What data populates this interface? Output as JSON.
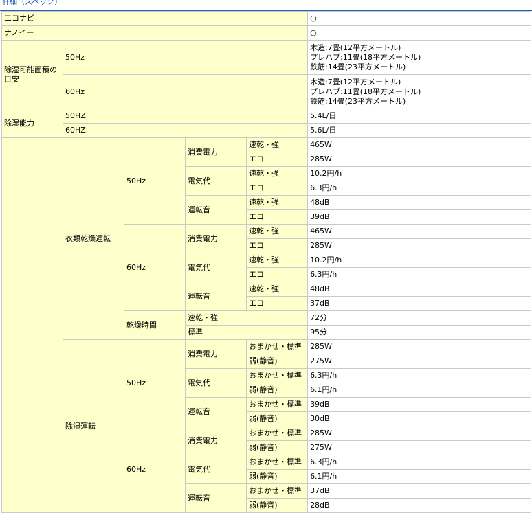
{
  "section_title": "詳細（スペック）",
  "rows": {
    "econavi": {
      "label": "エコナビ",
      "value": "○"
    },
    "nanoe": {
      "label": "ナノイー",
      "value": "○"
    },
    "area": {
      "label": "除湿可能面積の目安",
      "hz50": {
        "label": "50Hz",
        "lines": [
          "木造:7畳(12平方メートル)",
          "プレハブ:11畳(18平方メートル)",
          "鉄筋:14畳(23平方メートル)"
        ]
      },
      "hz60": {
        "label": "60Hz",
        "lines": [
          "木造:7畳(12平方メートル)",
          "プレハブ:11畳(18平方メートル)",
          "鉄筋:14畳(23平方メートル)"
        ]
      }
    },
    "capacity": {
      "label": "除湿能力",
      "hz50": {
        "label": "50HZ",
        "value": "5.4L/日"
      },
      "hz60": {
        "label": "60HZ",
        "value": "5.6L/日"
      }
    },
    "clothes": {
      "label": "衣類乾燥運転",
      "hz50": {
        "label": "50Hz",
        "power": {
          "label": "消費電力",
          "r1": {
            "mode": "速乾・強",
            "value": "465W"
          },
          "r2": {
            "mode": "エコ",
            "value": "285W"
          }
        },
        "cost": {
          "label": "電気代",
          "r1": {
            "mode": "速乾・強",
            "value": "10.2円/h"
          },
          "r2": {
            "mode": "エコ",
            "value": "6.3円/h"
          }
        },
        "noise": {
          "label": "運転音",
          "r1": {
            "mode": "速乾・強",
            "value": "48dB"
          },
          "r2": {
            "mode": "エコ",
            "value": "39dB"
          }
        }
      },
      "hz60": {
        "label": "60Hz",
        "power": {
          "label": "消費電力",
          "r1": {
            "mode": "速乾・強",
            "value": "465W"
          },
          "r2": {
            "mode": "エコ",
            "value": "285W"
          }
        },
        "cost": {
          "label": "電気代",
          "r1": {
            "mode": "速乾・強",
            "value": "10.2円/h"
          },
          "r2": {
            "mode": "エコ",
            "value": "6.3円/h"
          }
        },
        "noise": {
          "label": "運転音",
          "r1": {
            "mode": "速乾・強",
            "value": "48dB"
          },
          "r2": {
            "mode": "エコ",
            "value": "37dB"
          }
        }
      },
      "drying_time": {
        "label": "乾燥時間",
        "r1": {
          "mode": "速乾・強",
          "value": "72分"
        },
        "r2": {
          "mode": "標準",
          "value": "95分"
        }
      }
    },
    "dehumid": {
      "label": "除湿運転",
      "hz50": {
        "label": "50Hz",
        "power": {
          "label": "消費電力",
          "r1": {
            "mode": "おまかせ・標準",
            "value": "285W"
          },
          "r2": {
            "mode": "弱(静音)",
            "value": "275W"
          }
        },
        "cost": {
          "label": "電気代",
          "r1": {
            "mode": "おまかせ・標準",
            "value": "6.3円/h"
          },
          "r2": {
            "mode": "弱(静音)",
            "value": "6.1円/h"
          }
        },
        "noise": {
          "label": "運転音",
          "r1": {
            "mode": "おまかせ・標準",
            "value": "39dB"
          },
          "r2": {
            "mode": "弱(静音)",
            "value": "30dB"
          }
        }
      },
      "hz60": {
        "label": "60Hz",
        "power": {
          "label": "消費電力",
          "r1": {
            "mode": "おまかせ・標準",
            "value": "285W"
          },
          "r2": {
            "mode": "弱(静音)",
            "value": "275W"
          }
        },
        "cost": {
          "label": "電気代",
          "r1": {
            "mode": "おまかせ・標準",
            "value": "6.3円/h"
          },
          "r2": {
            "mode": "弱(静音)",
            "value": "6.1円/h"
          }
        },
        "noise": {
          "label": "運転音",
          "r1": {
            "mode": "おまかせ・標準",
            "value": "37dB"
          },
          "r2": {
            "mode": "弱(静音)",
            "value": "28dB"
          }
        }
      }
    }
  }
}
